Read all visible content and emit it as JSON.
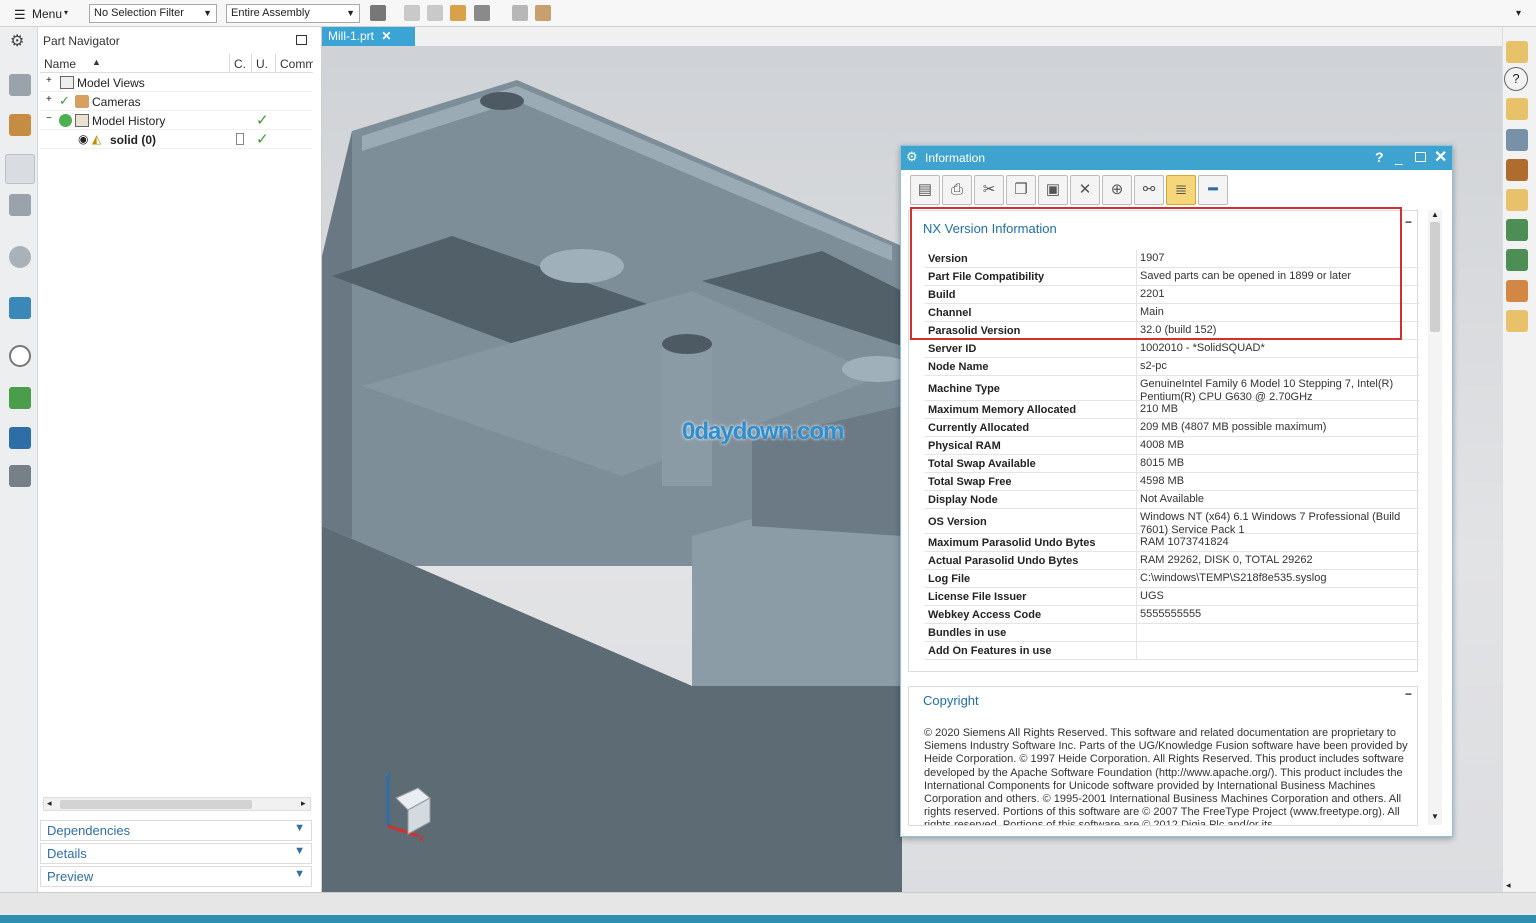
{
  "toolbar": {
    "menu_label": "Menu",
    "selection_filter": "No Selection Filter",
    "scope": "Entire Assembly"
  },
  "navigator": {
    "title": "Part Navigator",
    "columns": [
      "Name",
      "C.",
      "U.",
      "Comm"
    ],
    "rows": [
      {
        "label": "Model Views"
      },
      {
        "label": "Cameras"
      },
      {
        "label": "Model History"
      },
      {
        "label": "solid (0)"
      }
    ],
    "panels": [
      "Dependencies",
      "Details",
      "Preview"
    ]
  },
  "tab": {
    "label": "Mill-1.prt"
  },
  "watermark": "0daydown.com",
  "dialog": {
    "title": "Information",
    "section_title": "NX Version Information",
    "rows": [
      {
        "key": "Version",
        "value": "1907"
      },
      {
        "key": "Part File Compatibility",
        "value": "Saved parts can be opened in 1899 or later"
      },
      {
        "key": "Build",
        "value": "2201"
      },
      {
        "key": "Channel",
        "value": "Main"
      },
      {
        "key": "Parasolid Version",
        "value": "32.0 (build 152)"
      },
      {
        "key": "Server ID",
        "value": "1002010 - *SolidSQUAD*"
      },
      {
        "key": "Node Name",
        "value": "s2-pc"
      },
      {
        "key": "Machine Type",
        "value": "GenuineIntel Family 6 Model 10 Stepping 7, Intel(R) Pentium(R) CPU G630 @ 2.70GHz"
      },
      {
        "key": "Maximum Memory Allocated",
        "value": "210 MB"
      },
      {
        "key": "Currently Allocated",
        "value": "209 MB (4807 MB possible maximum)"
      },
      {
        "key": "Physical RAM",
        "value": "4008 MB"
      },
      {
        "key": "Total Swap Available",
        "value": "8015 MB"
      },
      {
        "key": "Total Swap Free",
        "value": "4598 MB"
      },
      {
        "key": "Display Node",
        "value": "Not Available"
      },
      {
        "key": "OS Version",
        "value": "Windows NT (x64) 6.1 Windows 7 Professional (Build 7601) Service Pack 1"
      },
      {
        "key": "Maximum Parasolid Undo Bytes",
        "value": "RAM 1073741824"
      },
      {
        "key": "Actual Parasolid Undo Bytes",
        "value": "RAM 29262, DISK 0, TOTAL 29262"
      },
      {
        "key": "Log File",
        "value": "C:\\windows\\TEMP\\S218f8e535.syslog"
      },
      {
        "key": "License File Issuer",
        "value": "UGS"
      },
      {
        "key": "Webkey Access Code",
        "value": "5555555555"
      },
      {
        "key": "Bundles in use",
        "value": ""
      },
      {
        "key": "Add On Features in use",
        "value": ""
      }
    ],
    "copyright_title": "Copyright",
    "copyright_text": "© 2020 Siemens All Rights Reserved. This software and related documentation are proprietary to Siemens Industry Software Inc. Parts of the UG/Knowledge Fusion software have been provided by Heide Corporation. © 1997 Heide Corporation. All Rights Reserved. This product includes software developed by the Apache Software Foundation (http://www.apache.org/). This product includes the International Components for Unicode software provided by International Business Machines Corporation and others. © 1995-2001 International Business Machines Corporation and others. All rights reserved. Portions of this software are © 2007 The FreeType Project (www.freetype.org). All rights reserved. Portions of this software are © 2012 Digia Plc and/or its"
  },
  "colors": {
    "accent": "#3fa3cf",
    "highlight": "#d32f2f",
    "model": "#8a9aa6"
  }
}
